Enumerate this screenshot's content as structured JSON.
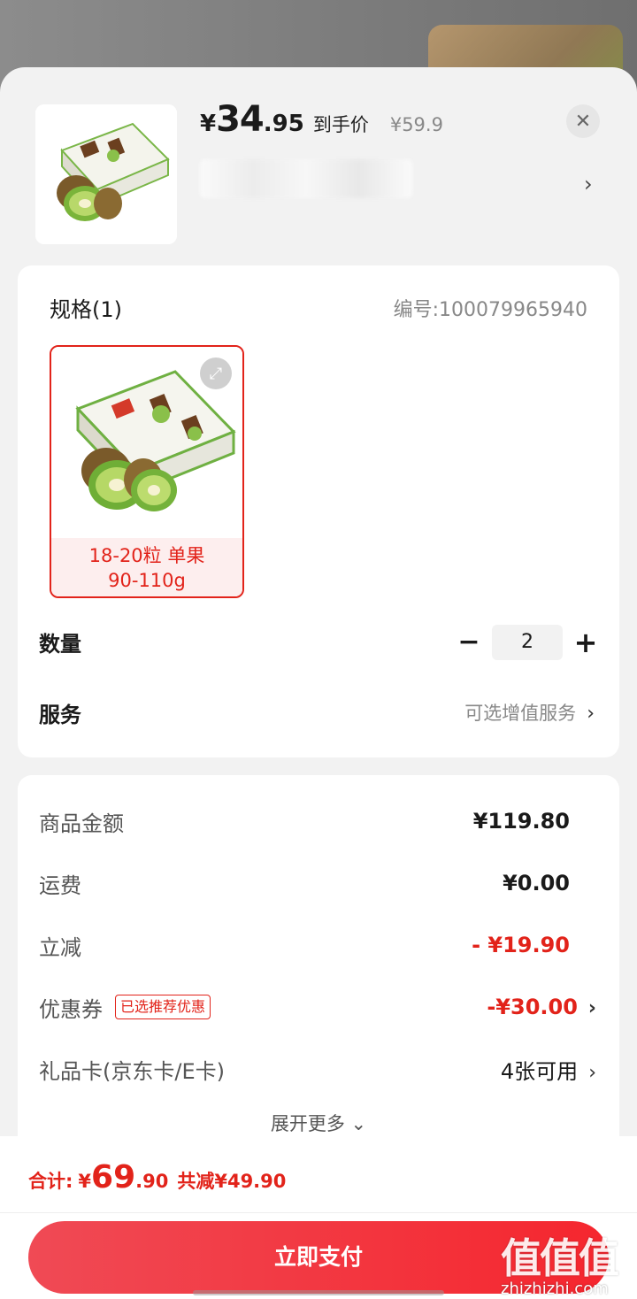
{
  "header": {
    "currency": "¥",
    "price_int": "34",
    "price_dec": ".95",
    "price_tag": "到手价",
    "original_price": "¥59.9",
    "close_symbol": "✕",
    "chevron": "›"
  },
  "spec": {
    "title": "规格(1)",
    "sku": "编号:100079965940",
    "option_line1": "18-20粒 单果",
    "option_line2": "90-110g"
  },
  "quantity": {
    "label": "数量",
    "minus": "−",
    "value": "2",
    "plus": "+"
  },
  "service": {
    "label": "服务",
    "value": "可选增值服务",
    "chevron": "›"
  },
  "summary": {
    "goods_label": "商品金额",
    "goods_value": "¥119.80",
    "shipping_label": "运费",
    "shipping_value": "¥0.00",
    "discount_label": "立减",
    "discount_value": "- ¥19.90",
    "coupon_label": "优惠券",
    "coupon_badge": "已选推荐优惠",
    "coupon_value": "-¥30.00",
    "giftcard_label": "礼品卡(京东卡/E卡)",
    "giftcard_value": "4张可用",
    "chevron": "›",
    "expand_more": "展开更多 ⌄"
  },
  "bottom": {
    "total_label": "合计:",
    "total_yen": "¥",
    "total_int": "69",
    "total_dec": ".90",
    "saving": "共减¥49.90",
    "pay_button": "立即支付"
  },
  "watermark": {
    "brand": "值值值",
    "site": "zhizhizhi.com"
  },
  "colors": {
    "accent": "#e2231a",
    "pay_gradient_start": "#f04a55",
    "pay_gradient_end": "#f5262e"
  },
  "icons": [
    "close-icon",
    "chevron-right-icon",
    "expand-image-icon",
    "minus-icon",
    "plus-icon",
    "chevron-down-icon"
  ]
}
